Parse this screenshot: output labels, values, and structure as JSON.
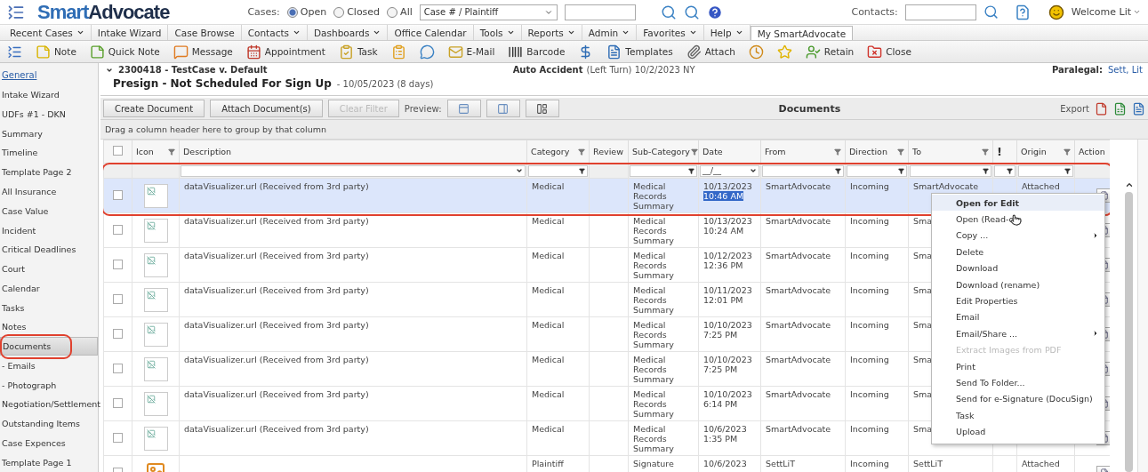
{
  "logo": {
    "brand": "Smart",
    "suffix": "Advocate"
  },
  "header": {
    "cases_label": "Cases:",
    "case_filters": [
      {
        "label": "Open",
        "selected": true
      },
      {
        "label": "Closed",
        "selected": false
      },
      {
        "label": "All",
        "selected": false
      }
    ],
    "search_type": "Case # / Plaintiff",
    "contacts_label": "Contacts:",
    "welcome": "Welcome Lit"
  },
  "menu": [
    {
      "label": "Recent Cases",
      "kind": "dropdown"
    },
    {
      "label": "Intake Wizard",
      "kind": "link"
    },
    {
      "label": "Case Browse",
      "kind": "link"
    },
    {
      "label": "Contacts",
      "kind": "dropdown"
    },
    {
      "label": "Dashboards",
      "kind": "dropdown"
    },
    {
      "label": "Office Calendar",
      "kind": "link"
    },
    {
      "label": "Tools",
      "kind": "dropdown"
    },
    {
      "label": "Reports",
      "kind": "dropdown"
    },
    {
      "label": "Admin",
      "kind": "dropdown"
    },
    {
      "label": "Favorites",
      "kind": "dropdown"
    },
    {
      "label": "Help",
      "kind": "dropdown"
    },
    {
      "label": "My SmartAdvocate",
      "kind": "tab"
    }
  ],
  "toolbar": [
    {
      "kind": "labeled",
      "label": "Note"
    },
    {
      "kind": "labeled",
      "label": "Quick Note"
    },
    {
      "kind": "labeled",
      "label": "Message"
    },
    {
      "kind": "labeled",
      "label": "Appointment"
    },
    {
      "kind": "labeled",
      "label": "Task"
    },
    {
      "kind": "icon"
    },
    {
      "kind": "icon"
    },
    {
      "kind": "labeled",
      "label": "E-Mail"
    },
    {
      "kind": "labeled",
      "label": "Barcode"
    },
    {
      "kind": "icon"
    },
    {
      "kind": "labeled",
      "label": "Templates"
    },
    {
      "kind": "labeled",
      "label": "Attach"
    },
    {
      "kind": "icon"
    },
    {
      "kind": "icon"
    },
    {
      "kind": "labeled",
      "label": "Retain"
    },
    {
      "kind": "labeled",
      "label": "Close"
    }
  ],
  "sidebar": {
    "items": [
      {
        "label": "General",
        "kind": "link",
        "selected": false
      },
      {
        "label": "Intake Wizard",
        "kind": "item",
        "selected": false
      },
      {
        "label": "UDFs #1 - DKN",
        "kind": "item",
        "selected": false
      },
      {
        "label": "Summary",
        "kind": "item",
        "selected": false
      },
      {
        "label": "Timeline",
        "kind": "item",
        "selected": false
      },
      {
        "label": "Template Page 2",
        "kind": "item",
        "selected": false
      },
      {
        "label": "All Insurance",
        "kind": "item",
        "selected": false
      },
      {
        "label": "Case Value",
        "kind": "item",
        "selected": false
      },
      {
        "label": "Incident",
        "kind": "item",
        "selected": false
      },
      {
        "label": "Critical Deadlines",
        "kind": "item",
        "selected": false
      },
      {
        "label": "Court",
        "kind": "item",
        "selected": false
      },
      {
        "label": "Calendar",
        "kind": "item",
        "selected": false
      },
      {
        "label": "Tasks",
        "kind": "item",
        "selected": false
      },
      {
        "label": "Notes",
        "kind": "item",
        "selected": false
      },
      {
        "label": "Documents",
        "kind": "item",
        "selected": true
      },
      {
        "label": "- Emails",
        "kind": "item",
        "selected": false
      },
      {
        "label": "- Photograph",
        "kind": "item",
        "selected": false
      },
      {
        "label": "Negotiation/Settlement",
        "kind": "item",
        "selected": false
      },
      {
        "label": "Outstanding Items",
        "kind": "item",
        "selected": false
      },
      {
        "label": "Case Expences",
        "kind": "item",
        "selected": false
      },
      {
        "label": "Template Page 1",
        "kind": "item",
        "selected": false
      }
    ]
  },
  "case": {
    "number": "2300418 - TestCase v. Default",
    "type": "Auto Accident",
    "type_detail": "(Left Turn) 10/2/2023 NY",
    "paralegal_label": "Paralegal:",
    "paralegal": "Sett, Lit",
    "status": "Presign - Not Scheduled For Sign Up",
    "status_date": "- 10/05/2023 (8 days)"
  },
  "documents": {
    "buttons": [
      {
        "label": "Create Document",
        "disabled": false
      },
      {
        "label": "Attach Document(s)",
        "disabled": false
      },
      {
        "label": "Clear Filter",
        "disabled": true
      }
    ],
    "preview_label": "Preview:",
    "title": "Documents",
    "export_label": "Export",
    "group_hint": "Drag a column header here to group by that column",
    "header_checkbox": {
      "checked": false
    },
    "columns": [
      {
        "kind": "checkbox"
      },
      {
        "kind": "icon",
        "label": "Icon",
        "filterable": true
      },
      {
        "kind": "description",
        "label": "Description",
        "filterable": false
      },
      {
        "kind": "category",
        "label": "Category",
        "filterable": true
      },
      {
        "kind": "review",
        "label": "Review",
        "filterable": false
      },
      {
        "kind": "subcategory",
        "label": "Sub-Category",
        "filterable": true
      },
      {
        "kind": "date",
        "label": "Date",
        "filterable": false,
        "filter_value": "__/__"
      },
      {
        "kind": "from",
        "label": "From",
        "filterable": true
      },
      {
        "kind": "direction",
        "label": "Direction",
        "filterable": true
      },
      {
        "kind": "to",
        "label": "To",
        "filterable": true
      },
      {
        "kind": "flag",
        "label": "!",
        "filterable": false
      },
      {
        "kind": "origin",
        "label": "Origin",
        "filterable": true
      },
      {
        "kind": "action",
        "label": "Action",
        "filterable": false
      }
    ],
    "rows": [
      {
        "selected": true,
        "checked": false,
        "kind": "broken",
        "description": "dataVisualizer.url (Received from 3rd party)",
        "category": "Medical",
        "subcategory": "Medical Records Summary",
        "date": "10/13/2023",
        "time": "10:46 AM",
        "time_selected": true,
        "from": "SmartAdvocate",
        "direction": "Incoming",
        "to": "SmartAdvocate",
        "origin": "Attached"
      },
      {
        "selected": false,
        "checked": false,
        "kind": "broken",
        "description": "dataVisualizer.url (Received from 3rd party)",
        "category": "Medical",
        "subcategory": "Medical Records Summary",
        "date": "10/13/2023",
        "time": "10:24 AM",
        "time_selected": false,
        "from": "SmartAdvocate",
        "direction": "Incoming",
        "to": "Sma"
      },
      {
        "selected": false,
        "checked": false,
        "kind": "broken",
        "description": "dataVisualizer.url (Received from 3rd party)",
        "category": "Medical",
        "subcategory": "Medical Records Summary",
        "date": "10/12/2023",
        "time": "12:36 PM",
        "time_selected": false,
        "from": "SmartAdvocate",
        "direction": "Incoming",
        "to": "Sma"
      },
      {
        "selected": false,
        "checked": false,
        "kind": "broken",
        "description": "dataVisualizer.url (Received from 3rd party)",
        "category": "Medical",
        "subcategory": "Medical Records Summary",
        "date": "10/11/2023",
        "time": "12:01 PM",
        "time_selected": false,
        "from": "SmartAdvocate",
        "direction": "Incoming",
        "to": "Sma"
      },
      {
        "selected": false,
        "checked": false,
        "kind": "broken",
        "description": "dataVisualizer.url (Received from 3rd party)",
        "category": "Medical",
        "subcategory": "Medical Records Summary",
        "date": "10/10/2023",
        "time": "7:25 PM",
        "time_selected": false,
        "from": "SmartAdvocate",
        "direction": "Incoming",
        "to": "Sma"
      },
      {
        "selected": false,
        "checked": false,
        "kind": "broken",
        "description": "dataVisualizer.url (Received from 3rd party)",
        "category": "Medical",
        "subcategory": "Medical Records Summary",
        "date": "10/10/2023",
        "time": "7:25 PM",
        "time_selected": false,
        "from": "SmartAdvocate",
        "direction": "Incoming",
        "to": "Sma"
      },
      {
        "selected": false,
        "checked": false,
        "kind": "broken",
        "description": "dataVisualizer.url (Received from 3rd party)",
        "category": "Medical",
        "subcategory": "Medical Records Summary",
        "date": "10/10/2023",
        "time": "6:14 PM",
        "time_selected": false,
        "from": "SmartAdvocate",
        "direction": "Incoming",
        "to": "Sma"
      },
      {
        "selected": false,
        "checked": false,
        "kind": "broken",
        "description": "dataVisualizer.url (Received from 3rd party)",
        "category": "Medical",
        "subcategory": "Medical Records Summary",
        "date": "10/6/2023",
        "time": "1:35 PM",
        "time_selected": false,
        "from": "SmartAdvocate",
        "direction": "Incoming",
        "to": "Sma"
      },
      {
        "selected": false,
        "checked": false,
        "kind": "document",
        "category": "Plaintiff",
        "subcategory": "Signature",
        "date": "10/6/2023",
        "from": "SettLiT",
        "direction": "Incoming",
        "to": "SettLiT",
        "origin": "Attached"
      }
    ],
    "context_menu": [
      {
        "label": "Open for Edit",
        "selected": true,
        "disabled": false,
        "has_submenu": false
      },
      {
        "label": "Open (Read-o",
        "selected": false,
        "disabled": false,
        "has_submenu": false
      },
      {
        "label": "Copy ...",
        "selected": false,
        "disabled": false,
        "has_submenu": true
      },
      {
        "label": "Delete",
        "selected": false,
        "disabled": false,
        "has_submenu": false
      },
      {
        "label": "Download",
        "selected": false,
        "disabled": false,
        "has_submenu": false
      },
      {
        "label": "Download (rename)",
        "selected": false,
        "disabled": false,
        "has_submenu": false
      },
      {
        "label": "Edit Properties",
        "selected": false,
        "disabled": false,
        "has_submenu": false
      },
      {
        "label": "Email",
        "selected": false,
        "disabled": false,
        "has_submenu": false
      },
      {
        "label": "Email/Share ...",
        "selected": false,
        "disabled": false,
        "has_submenu": true
      },
      {
        "label": "Extract Images from PDF",
        "selected": false,
        "disabled": true,
        "has_submenu": false
      },
      {
        "label": "Print",
        "selected": false,
        "disabled": false,
        "has_submenu": false
      },
      {
        "label": "Send To Folder...",
        "selected": false,
        "disabled": false,
        "has_submenu": false
      },
      {
        "label": "Send for e-Signature (DocuSign)",
        "selected": false,
        "disabled": false,
        "has_submenu": false
      },
      {
        "label": "Task",
        "selected": false,
        "disabled": false,
        "has_submenu": false
      },
      {
        "label": "Upload",
        "selected": false,
        "disabled": false,
        "has_submenu": false
      }
    ]
  }
}
